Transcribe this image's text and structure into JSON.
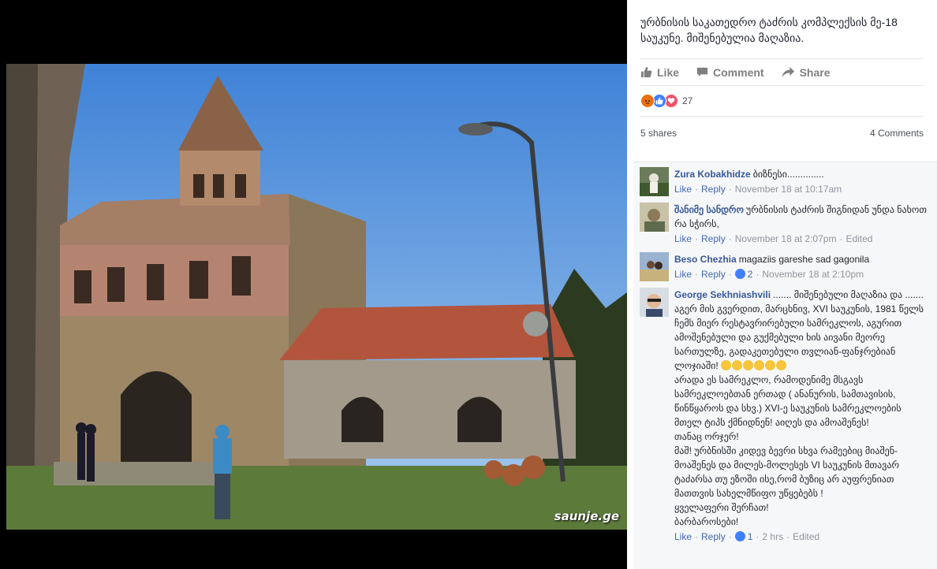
{
  "photo": {
    "watermark": "saunje.ge"
  },
  "post": {
    "text": "ურბნისის საკათედრო ტაძრის კომპლექსის მე-18 საუკუნე. მიშენებულია მაღაზია.",
    "actions": {
      "like": "Like",
      "comment": "Comment",
      "share": "Share"
    },
    "reaction_count": "27",
    "shares": "5 shares",
    "comments_count": "4 Comments"
  },
  "comments": [
    {
      "name": "Zura Kobakhidze",
      "text": "ბიზნესი..............",
      "like": "Like",
      "reply": "Reply",
      "time": "November 18 at 10:17am"
    },
    {
      "name": "შანიმე სანდრო",
      "text": "ურბნისის ტაძრის შიგნიდან უნდა ნახოთ რა სჭირს,",
      "like": "Like",
      "reply": "Reply",
      "time": "November 18 at 2:07pm",
      "edited": "Edited"
    },
    {
      "name": "Beso Chezhia",
      "text": "magaziis gareshe sad gagonila",
      "like": "Like",
      "reply": "Reply",
      "likes": "2",
      "time": "November 18 at 2:10pm"
    },
    {
      "name": "George Sekhniashvili",
      "lines": [
        "....... მიშენებული მაღაზია და ....... აგერ მის გვერდით, მარცხნივ, XVI საუკუნის, 1981 წელს ჩემს მიერ რესტავრირებული სამრეკლოს, აგურით ამოშენებული და გუქმებული ხის აივანი მეორე სართულზე, გადაკეთებული თვლიან-ფანჯრებიან ლოჯიაში!",
        "არადა ეს სამრეკლო, რამოდენიმე მსგავს სამრეკლოებთან ერთად ( ანანურის, სამთავისის, წინწყაროს და სხვ.) XVI-ე საუკუნის სამრეკლოების მთელ ტიპს ქმნიდნენ! აიღეს და ამოაშენეს!",
        "თანაც ორჯერ!",
        "მაშ! ურბნისში კიდევ ბევრი სხვა რამეებიც მიაშენ-მოაშენეს და მილეს-მოლესეს VI საუკუნის მთავარ ტაძარსა თუ ეზოში ისე,რომ ბუზიც არ აუფრენიათ მათთვის სახელმწიფო უწყებებს !",
        "ყველაფერი შერჩათ!",
        "ბარბაროსები!"
      ],
      "like": "Like",
      "reply": "Reply",
      "likes": "1",
      "time": "2 hrs",
      "edited": "Edited"
    }
  ],
  "colors": {
    "link": "#365899",
    "meta": "#90949c",
    "like_blue": "#4267b2"
  }
}
